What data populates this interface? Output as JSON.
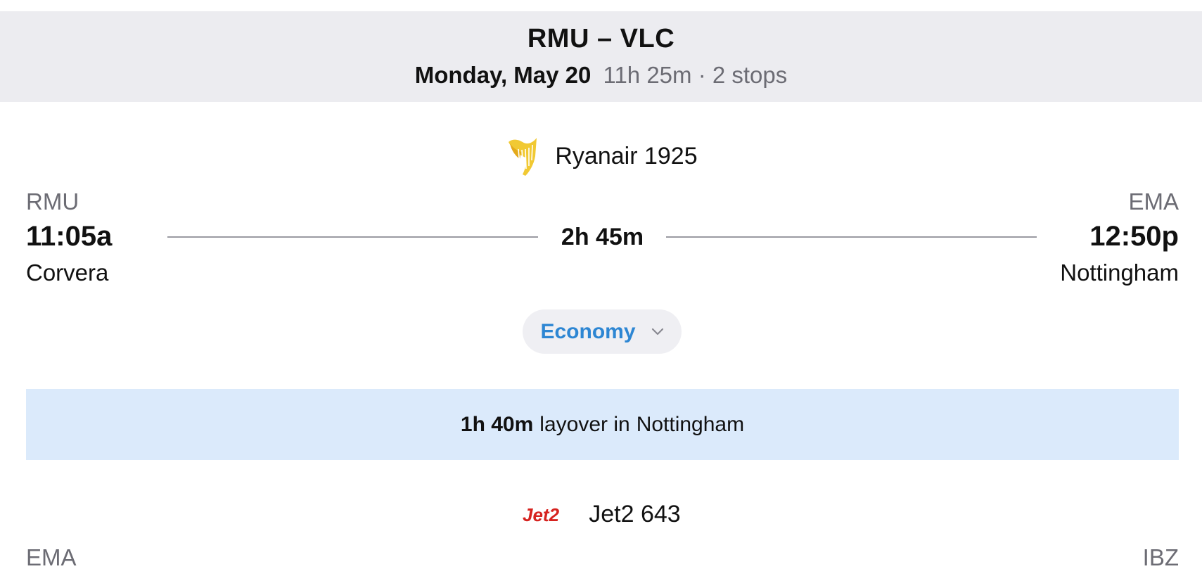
{
  "header": {
    "route": "RMU – VLC",
    "date": "Monday, May 20",
    "summary": "11h 25m · 2 stops"
  },
  "segments": [
    {
      "airline": "Ryanair 1925",
      "airline_logo_icon": "ryanair-harp-icon",
      "origin_code": "RMU",
      "departure_time": "11:05a",
      "origin_city": "Corvera",
      "duration": "2h 45m",
      "destination_code": "EMA",
      "arrival_time": "12:50p",
      "destination_city": "Nottingham",
      "cabin": "Economy"
    },
    {
      "airline": "Jet2 643",
      "airline_logo_text": "Jet2",
      "origin_code": "EMA",
      "destination_code": "IBZ"
    }
  ],
  "layover": {
    "duration": "1h 40m",
    "text": "layover in",
    "location": "Nottingham"
  },
  "colors": {
    "header_bg": "#ececf0",
    "layover_bg": "#dbeafb",
    "accent_blue": "#2d86d3",
    "ryanair_yellow": "#f1c933",
    "jet2_red": "#d6231f"
  }
}
